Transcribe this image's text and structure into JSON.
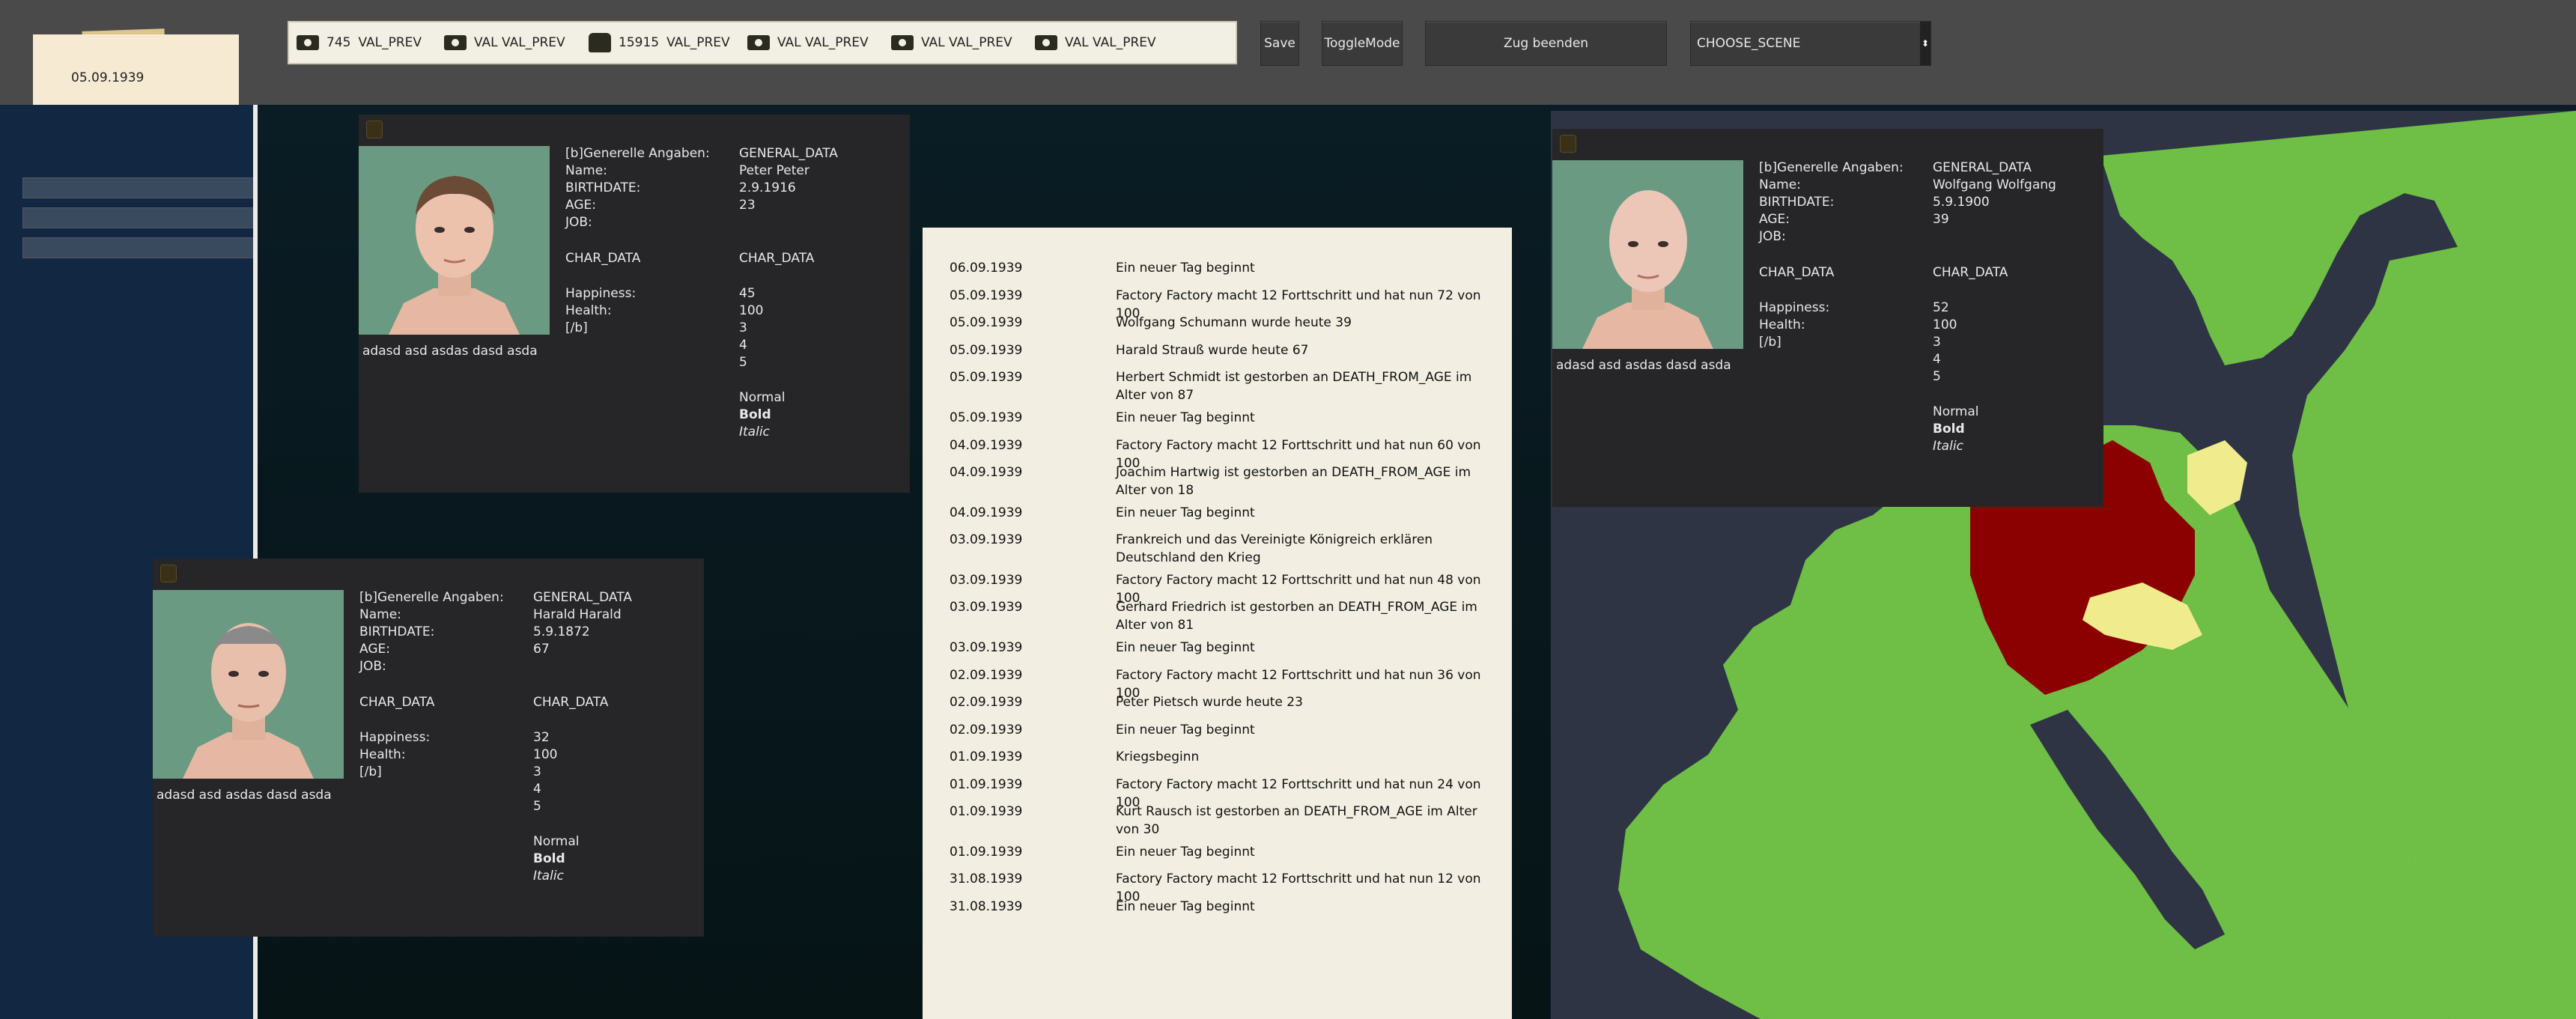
{
  "date": "05.09.1939",
  "resources": [
    {
      "icon": "money-icon",
      "amount": "745",
      "label": "VAL_PREV"
    },
    {
      "icon": "money-icon",
      "amount": "",
      "label": "VAL VAL_PREV"
    },
    {
      "icon": "helmet-icon",
      "amount": "15915",
      "label": "VAL_PREV"
    },
    {
      "icon": "money-icon",
      "amount": "",
      "label": "VAL VAL_PREV"
    },
    {
      "icon": "money-icon",
      "amount": "",
      "label": "VAL VAL_PREV"
    },
    {
      "icon": "money-icon",
      "amount": "",
      "label": "VAL VAL_PREV"
    }
  ],
  "buttons": {
    "save": "Save",
    "toggle": "ToggleMode",
    "end_turn": "Zug beenden",
    "scene": "CHOOSE_SCENE"
  },
  "colors": {
    "topbar": "#4a4a4a",
    "card_bg": "#262628",
    "log_bg": "#f2efe2",
    "sea": "#2e3444",
    "land": "#6fbe45",
    "germany": "#8b0000",
    "highlight": "#f0ec8e"
  },
  "labels": {
    "general": "[b]Generelle Angaben:",
    "name": "Name:",
    "birthdate": "BIRTHDATE:",
    "age": "AGE:",
    "job": "JOB:",
    "char_data": "CHAR_DATA",
    "happiness": "Happiness:",
    "health": "Health:",
    "end_b": "[/b]"
  },
  "cards": [
    {
      "general": "GENERAL_DATA",
      "name": "Peter Peter",
      "birthdate": "2.9.1916",
      "age": "23",
      "char_data": "CHAR_DATA",
      "happiness": "45",
      "health": "100",
      "n3": "3",
      "n4": "4",
      "n5": "5",
      "normal": "Normal",
      "bold": "Bold",
      "italic": "Italic",
      "caption": "adasd asd asdas dasd asda"
    },
    {
      "general": "GENERAL_DATA",
      "name": "Harald Harald",
      "birthdate": "5.9.1872",
      "age": "67",
      "char_data": "CHAR_DATA",
      "happiness": "32",
      "health": "100",
      "n3": "3",
      "n4": "4",
      "n5": "5",
      "normal": "Normal",
      "bold": "Bold",
      "italic": "Italic",
      "caption": "adasd asd asdas dasd asda"
    },
    {
      "general": "GENERAL_DATA",
      "name": "Wolfgang Wolfgang",
      "birthdate": "5.9.1900",
      "age": "39",
      "char_data": "CHAR_DATA",
      "happiness": "52",
      "health": "100",
      "n3": "3",
      "n4": "4",
      "n5": "5",
      "normal": "Normal",
      "bold": "Bold",
      "italic": "Italic",
      "caption": "adasd asd asdas dasd asda"
    }
  ],
  "log": [
    {
      "date": "06.09.1939",
      "text": "Ein neuer Tag beginnt"
    },
    {
      "date": "05.09.1939",
      "text": "Factory Factory macht 12 Forttschritt und hat nun 72 von 100"
    },
    {
      "date": "05.09.1939",
      "text": "Wolfgang Schumann  wurde heute 39"
    },
    {
      "date": "05.09.1939",
      "text": "Harald Strauß  wurde heute 67"
    },
    {
      "date": "05.09.1939",
      "text": "Herbert Schmidt  ist gestorben an DEATH_FROM_AGE im Alter von 87"
    },
    {
      "date": "05.09.1939",
      "text": "Ein neuer Tag beginnt"
    },
    {
      "date": "04.09.1939",
      "text": "Factory Factory macht 12 Forttschritt und hat nun 60 von 100"
    },
    {
      "date": "04.09.1939",
      "text": "Joachim Hartwig  ist gestorben an DEATH_FROM_AGE im Alter von 18"
    },
    {
      "date": "04.09.1939",
      "text": "Ein neuer Tag beginnt"
    },
    {
      "date": "03.09.1939",
      "text": "Frankreich und das Vereinigte Königreich erklären Deutschland den Krieg"
    },
    {
      "date": "03.09.1939",
      "text": "Factory Factory macht 12 Forttschritt und hat nun 48 von 100"
    },
    {
      "date": "03.09.1939",
      "text": "Gerhard Friedrich  ist gestorben an DEATH_FROM_AGE im Alter von 81"
    },
    {
      "date": "03.09.1939",
      "text": "Ein neuer Tag beginnt"
    },
    {
      "date": "02.09.1939",
      "text": "Factory Factory macht 12 Forttschritt und hat nun 36 von 100"
    },
    {
      "date": "02.09.1939",
      "text": "Peter Pietsch  wurde heute 23"
    },
    {
      "date": "02.09.1939",
      "text": "Ein neuer Tag beginnt"
    },
    {
      "date": "01.09.1939",
      "text": "Kriegsbeginn"
    },
    {
      "date": "01.09.1939",
      "text": "Factory Factory macht 12 Forttschritt und hat nun 24 von 100"
    },
    {
      "date": "01.09.1939",
      "text": "Kurt Rausch  ist gestorben an DEATH_FROM_AGE im Alter von 30"
    },
    {
      "date": "01.09.1939",
      "text": "Ein neuer Tag beginnt"
    },
    {
      "date": "31.08.1939",
      "text": "Factory Factory macht 12 Forttschritt und hat nun 12 von 100"
    },
    {
      "date": "31.08.1939",
      "text": "Ein neuer Tag beginnt"
    }
  ]
}
